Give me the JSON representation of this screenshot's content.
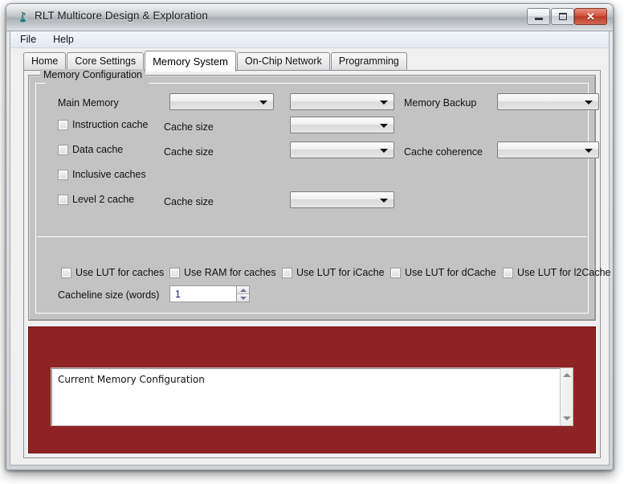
{
  "window": {
    "title": "RLT Multicore Design & Exploration",
    "icon": "java-app-icon",
    "controls": {
      "minimize": "minimize-button",
      "maximize": "maximize-button",
      "close_label": "✕"
    }
  },
  "menu": {
    "items": [
      {
        "label": "File"
      },
      {
        "label": "Help"
      }
    ]
  },
  "tabs": [
    {
      "label": "Home",
      "active": false
    },
    {
      "label": "Core Settings",
      "active": false
    },
    {
      "label": "Memory System",
      "active": true
    },
    {
      "label": "On-Chip Network",
      "active": false
    },
    {
      "label": "Programming",
      "active": false
    }
  ],
  "memory_configuration": {
    "group_title": "Memory Configuration",
    "main_memory_label": "Main Memory",
    "main_memory_value": "",
    "main_memory_second_value": "",
    "memory_backup_label": "Memory Backup",
    "memory_backup_value": "",
    "instruction_cache_label": "Instruction cache",
    "instruction_cache_size_label": "Cache size",
    "instruction_cache_size_value": "",
    "data_cache_label": "Data cache",
    "data_cache_size_label": "Cache size",
    "data_cache_size_value": "",
    "cache_coherence_label": "Cache coherence",
    "cache_coherence_value": "",
    "inclusive_caches_label": "Inclusive caches",
    "level2_cache_label": "Level 2 cache",
    "level2_cache_size_label": "Cache size",
    "level2_cache_size_value": "",
    "cacheline_size_label": "Cacheline size (words)",
    "cacheline_size_value": "1",
    "lut_options": [
      {
        "label": "Use LUT for caches"
      },
      {
        "label": "Use RAM for caches"
      },
      {
        "label": "Use LUT for iCache"
      },
      {
        "label": "Use LUT for dCache"
      },
      {
        "label": "Use LUT for l2Cache"
      }
    ]
  },
  "output": {
    "text": "Current Memory Configuration",
    "panel_color": "#8f2222"
  }
}
